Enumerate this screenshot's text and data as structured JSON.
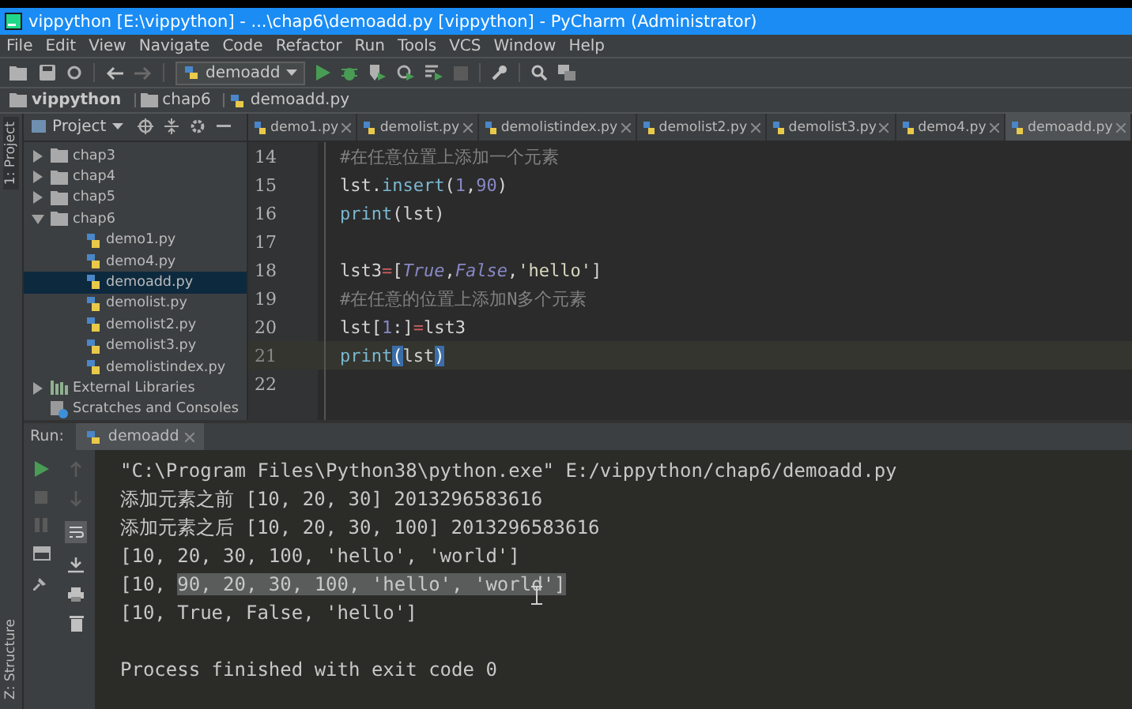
{
  "window": {
    "title": "vippython [E:\\vippython] - ...\\chap6\\demoadd.py [vippython] - PyCharm (Administrator)"
  },
  "menu": [
    "File",
    "Edit",
    "View",
    "Navigate",
    "Code",
    "Refactor",
    "Run",
    "Tools",
    "VCS",
    "Window",
    "Help"
  ],
  "toolbar": {
    "run_config": "demoadd"
  },
  "breadcrumb": [
    {
      "label": "vippython",
      "kind": "folder"
    },
    {
      "label": "chap6",
      "kind": "folder"
    },
    {
      "label": "demoadd.py",
      "kind": "python-file"
    }
  ],
  "side_stripe": {
    "top": "1: Project",
    "bottom": "Z: Structure"
  },
  "project_panel": {
    "title": "Project",
    "tree": [
      {
        "label": "chap3",
        "kind": "folder",
        "expanded": false,
        "selected": false
      },
      {
        "label": "chap4",
        "kind": "folder",
        "expanded": false,
        "selected": false
      },
      {
        "label": "chap5",
        "kind": "folder",
        "expanded": false,
        "selected": false
      },
      {
        "label": "chap6",
        "kind": "folder",
        "expanded": true,
        "selected": false,
        "children": [
          {
            "label": "demo1.py",
            "kind": "python-file",
            "selected": false
          },
          {
            "label": "demo4.py",
            "kind": "python-file",
            "selected": false
          },
          {
            "label": "demoadd.py",
            "kind": "python-file",
            "selected": true
          },
          {
            "label": "demolist.py",
            "kind": "python-file",
            "selected": false
          },
          {
            "label": "demolist2.py",
            "kind": "python-file",
            "selected": false
          },
          {
            "label": "demolist3.py",
            "kind": "python-file",
            "selected": false
          },
          {
            "label": "demolistindex.py",
            "kind": "python-file",
            "selected": false
          }
        ]
      },
      {
        "label": "External Libraries",
        "kind": "library",
        "expanded": false,
        "selected": false
      },
      {
        "label": "Scratches and Consoles",
        "kind": "scratches",
        "selected": false
      }
    ]
  },
  "editor_tabs": [
    {
      "label": "demo1.py",
      "selected": false
    },
    {
      "label": "demolist.py",
      "selected": false
    },
    {
      "label": "demolistindex.py",
      "selected": false
    },
    {
      "label": "demolist2.py",
      "selected": false
    },
    {
      "label": "demolist3.py",
      "selected": false
    },
    {
      "label": "demo4.py",
      "selected": false
    },
    {
      "label": "demoadd.py",
      "selected": true
    }
  ],
  "code_lines": [
    {
      "number": "14",
      "current": false,
      "tokens": [
        {
          "text": "#在任意位置上添加一个元素",
          "kind": "comment"
        }
      ]
    },
    {
      "number": "15",
      "current": false,
      "tokens": [
        {
          "text": "lst.",
          "kind": "plain"
        },
        {
          "text": "insert",
          "kind": "function"
        },
        {
          "text": "(",
          "kind": "plain"
        },
        {
          "text": "1",
          "kind": "number"
        },
        {
          "text": ",",
          "kind": "plain"
        },
        {
          "text": "90",
          "kind": "number"
        },
        {
          "text": ")",
          "kind": "plain"
        }
      ]
    },
    {
      "number": "16",
      "current": false,
      "tokens": [
        {
          "text": "print",
          "kind": "function"
        },
        {
          "text": "(lst)",
          "kind": "plain"
        }
      ]
    },
    {
      "number": "17",
      "current": false
    },
    {
      "number": "18",
      "current": false,
      "tokens": [
        {
          "text": "lst3",
          "kind": "plain"
        },
        {
          "text": "=",
          "kind": "operator"
        },
        {
          "text": "[",
          "kind": "plain"
        },
        {
          "text": "True",
          "kind": "constant"
        },
        {
          "text": ",",
          "kind": "plain"
        },
        {
          "text": "False",
          "kind": "constant"
        },
        {
          "text": ",",
          "kind": "plain"
        },
        {
          "text": "'hello'",
          "kind": "string"
        },
        {
          "text": "]",
          "kind": "plain"
        }
      ]
    },
    {
      "number": "19",
      "current": false,
      "tokens": [
        {
          "text": "#在任意的位置上添加N多个元素",
          "kind": "comment"
        }
      ]
    },
    {
      "number": "20",
      "current": false,
      "tokens": [
        {
          "text": "lst[",
          "kind": "plain"
        },
        {
          "text": "1",
          "kind": "number"
        },
        {
          "text": ":]",
          "kind": "plain"
        },
        {
          "text": "=",
          "kind": "operator"
        },
        {
          "text": "lst3",
          "kind": "plain"
        }
      ]
    },
    {
      "number": "21",
      "current": true,
      "tokens": [
        {
          "text": "print",
          "kind": "function"
        },
        {
          "text": "(",
          "kind": "bracket-match"
        },
        {
          "text": "lst",
          "kind": "plain"
        },
        {
          "text": ")",
          "kind": "bracket-match"
        }
      ]
    },
    {
      "number": "22",
      "current": false
    }
  ],
  "run_panel": {
    "label": "Run:",
    "tab": "demoadd",
    "output": [
      {
        "segments": [
          {
            "text": "\"C:\\Program Files\\Python38\\python.exe\" E:/vippython/chap6/demoadd.py",
            "selected": false
          }
        ]
      },
      {
        "segments": [
          {
            "text": "添加元素之前 [10, 20, 30] 2013296583616",
            "selected": false
          }
        ]
      },
      {
        "segments": [
          {
            "text": "添加元素之后 [10, 20, 30, 100] 2013296583616",
            "selected": false
          }
        ]
      },
      {
        "segments": [
          {
            "text": "[10, 20, 30, 100, 'hello', 'world']",
            "selected": false
          }
        ]
      },
      {
        "segments": [
          {
            "text": "[10, ",
            "selected": false
          },
          {
            "text": "90, 20, 30, 100, 'hello', 'world']",
            "selected": true
          }
        ]
      },
      {
        "segments": [
          {
            "text": "[10, True, False, 'hello']",
            "selected": false
          }
        ]
      }
    ],
    "exit_message": "Process finished with exit code 0"
  }
}
